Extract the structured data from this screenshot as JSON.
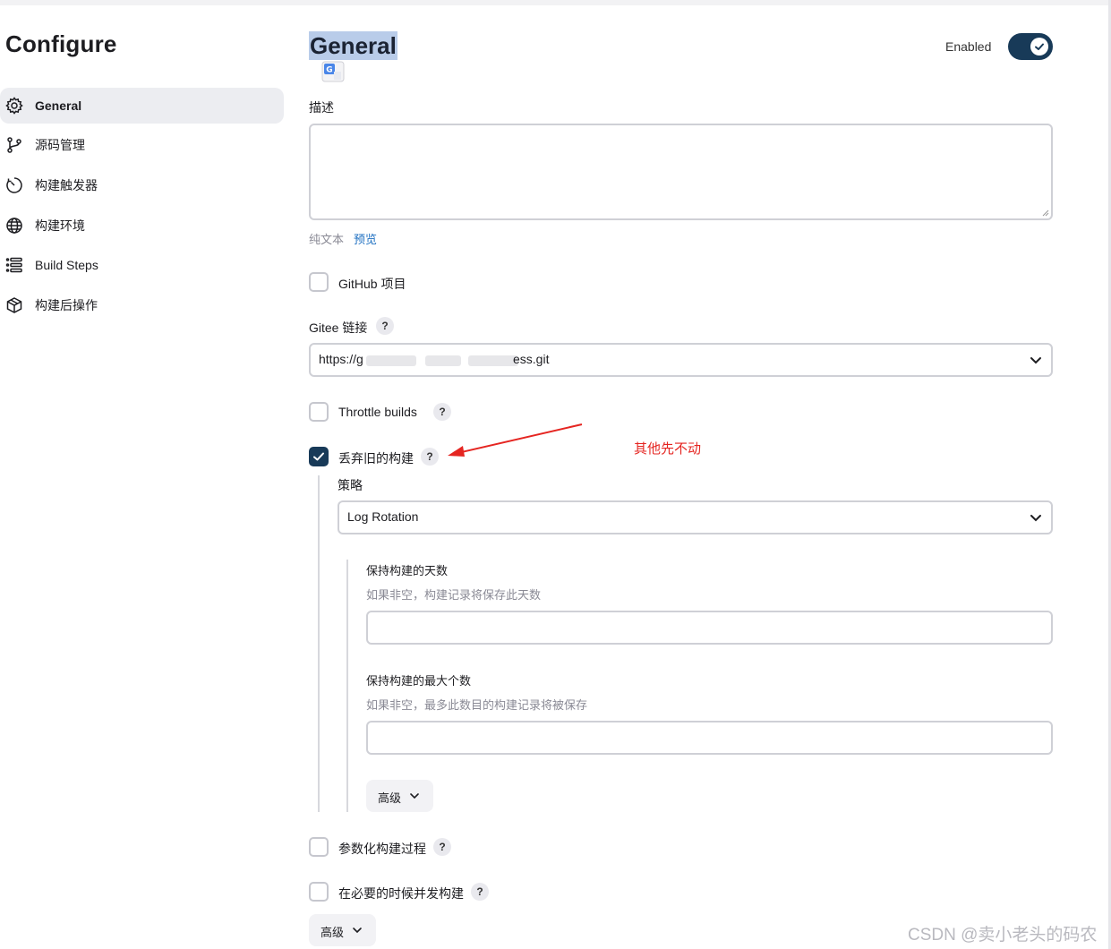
{
  "page": {
    "title": "Configure"
  },
  "sidebar": {
    "items": [
      {
        "label": "General",
        "icon": "gear-icon",
        "active": true
      },
      {
        "label": "源码管理",
        "icon": "branch-icon"
      },
      {
        "label": "构建触发器",
        "icon": "timer-icon"
      },
      {
        "label": "构建环境",
        "icon": "globe-icon"
      },
      {
        "label": "Build Steps",
        "icon": "list-icon"
      },
      {
        "label": "构建后操作",
        "icon": "cube-icon"
      }
    ]
  },
  "main": {
    "section_title": "General",
    "enabled": {
      "label": "Enabled",
      "value": true
    },
    "description": {
      "label": "描述",
      "value": "",
      "format_label": "纯文本",
      "preview_link": "预览"
    },
    "github_project": {
      "label": "GitHub 项目",
      "checked": false
    },
    "gitee": {
      "label": "Gitee 链接",
      "help": "?",
      "url_prefix": "https://g",
      "url_suffix": "ess.git"
    },
    "throttle_builds": {
      "label": "Throttle builds",
      "checked": false,
      "help": "?"
    },
    "discard_old_builds": {
      "label": "丢弃旧的构建",
      "checked": true,
      "help": "?",
      "strategy": {
        "label": "策略",
        "value": "Log Rotation"
      },
      "days_to_keep": {
        "label": "保持构建的天数",
        "hint": "如果非空，构建记录将保存此天数",
        "value": ""
      },
      "max_builds": {
        "label": "保持构建的最大个数",
        "hint": "如果非空，最多此数目的构建记录将被保存",
        "value": ""
      },
      "advanced_label": "高级"
    },
    "parameterized": {
      "label": "参数化构建过程",
      "checked": false,
      "help": "?"
    },
    "concurrent": {
      "label": "在必要的时候并发构建",
      "checked": false,
      "help": "?"
    },
    "advanced_label": "高级"
  },
  "annotation": {
    "text": "其他先不动",
    "color": "#e52521"
  },
  "watermark": "CSDN @卖小老头的码农",
  "colors": {
    "accent": "#183a58",
    "highlight": "#b9cce9",
    "link": "#1d6fc1"
  }
}
